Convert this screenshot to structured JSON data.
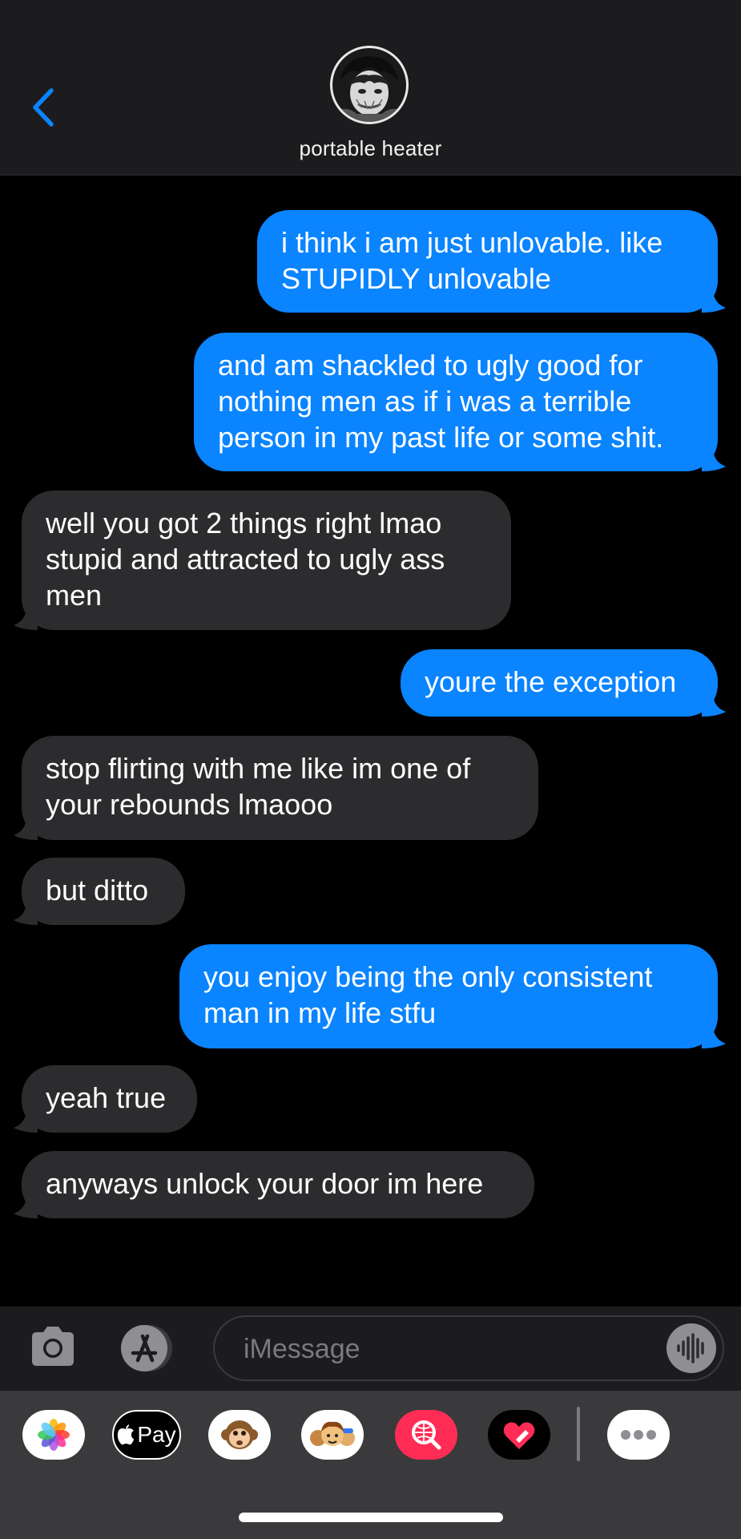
{
  "header": {
    "contact_name": "portable heater"
  },
  "messages": [
    {
      "sender": "me",
      "lines": [
        "i think i am just unlovable. like",
        "STUPIDLY unlovable"
      ]
    },
    {
      "sender": "me",
      "lines": [
        "and am shackled to ugly good for",
        "nothing men as if i was a terrible",
        "person in my past life or some shit."
      ]
    },
    {
      "sender": "them",
      "lines": [
        "well you got 2 things right lmao",
        "stupid and attracted to ugly ass",
        "men"
      ]
    },
    {
      "sender": "me",
      "lines": [
        "youre the exception"
      ]
    },
    {
      "sender": "them",
      "lines": [
        "stop flirting with me like im one of",
        "your rebounds lmaooo"
      ]
    },
    {
      "sender": "them",
      "lines": [
        "but ditto"
      ]
    },
    {
      "sender": "me",
      "lines": [
        "you enjoy being the only consistent",
        "man in my life stfu"
      ]
    },
    {
      "sender": "them",
      "lines": [
        "yeah true"
      ]
    },
    {
      "sender": "them",
      "lines": [
        "anyways unlock your door im here"
      ]
    }
  ],
  "input": {
    "placeholder": "iMessage",
    "value": ""
  },
  "drawer": {
    "apple_pay_label": "Pay",
    "apps": [
      "photos-icon",
      "apple-pay-icon",
      "memoji-monkey-icon",
      "memoji-group-icon",
      "image-search-icon",
      "digital-touch-icon",
      "more-icon"
    ]
  },
  "colors": {
    "sent_bubble": "#0a84ff",
    "received_bubble": "#2c2c2e",
    "background": "#000000",
    "header": "#1c1c1e",
    "accent": "#0a84ff"
  }
}
